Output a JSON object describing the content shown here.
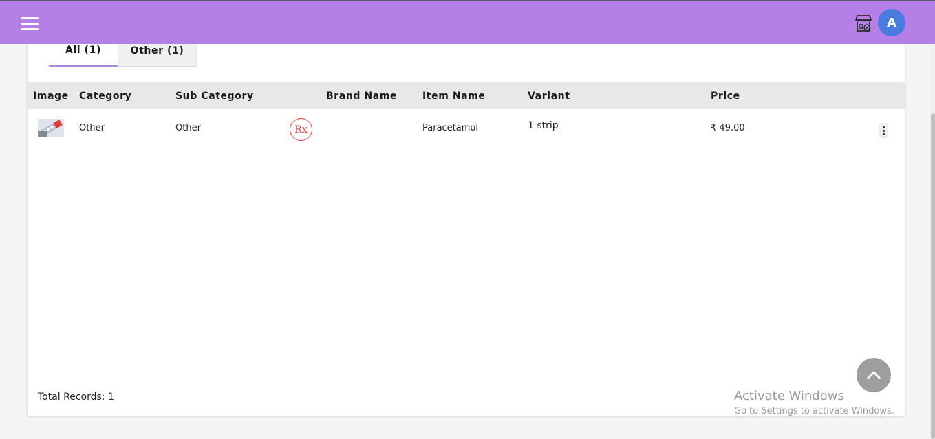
{
  "header": {
    "menu_icon": "hamburger-icon",
    "store_icon": "store-icon",
    "avatar_initial": "A",
    "bar_color": "#b57fe8",
    "avatar_color": "#4a7be0"
  },
  "tabs": [
    {
      "label": "All (1)",
      "active": true
    },
    {
      "label": "Other (1)",
      "active": false
    }
  ],
  "table": {
    "columns": [
      "Image",
      "Category",
      "Sub Category",
      "Brand Name",
      "Item Name",
      "Variant",
      "Price"
    ],
    "rows": [
      {
        "image": "product-thumbnail",
        "category": "Other",
        "sub_category": "Other",
        "rx_badge": "Rx",
        "rx_badge_color": "#e53935",
        "brand_name": "",
        "item_name": "Paracetamol",
        "variant": "1 strip",
        "price": "₹ 49.00"
      }
    ]
  },
  "footer": {
    "total_records": "Total Records: 1"
  },
  "watermark": {
    "line1": "Activate Windows",
    "line2": "Go to Settings to activate Windows."
  }
}
